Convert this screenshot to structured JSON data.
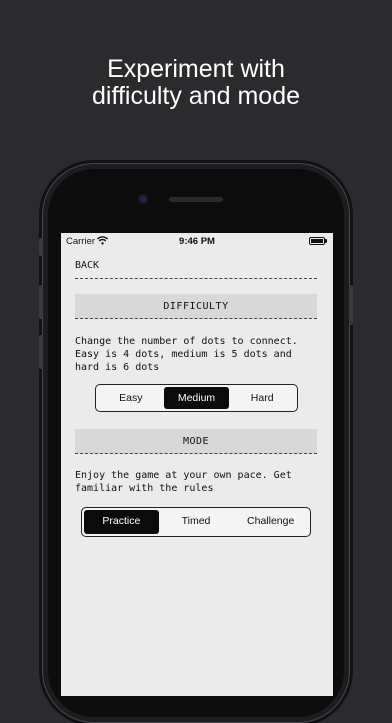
{
  "headline": {
    "line1": "Experiment with",
    "line2": "difficulty and mode"
  },
  "statusbar": {
    "carrier": "Carrier",
    "time": "9:46 PM"
  },
  "nav": {
    "back_label": "BACK"
  },
  "difficulty": {
    "header": "DIFFICULTY",
    "description": [
      "Change the number of dots to connect.",
      "Easy is 4 dots, medium is 5 dots and",
      "hard is 6 dots"
    ],
    "options": [
      "Easy",
      "Medium",
      "Hard"
    ],
    "selected": "Medium"
  },
  "mode": {
    "header": "MODE",
    "description": [
      "Enjoy the game at your own pace. Get",
      "familiar with the rules"
    ],
    "options": [
      "Practice",
      "Timed",
      "Challenge"
    ],
    "selected": "Practice"
  },
  "colors": {
    "background": "#2b2b2e",
    "screen": "#ebebeb",
    "accent": "#0b0b0b"
  },
  "icons": [
    "wifi-icon",
    "battery-icon"
  ]
}
